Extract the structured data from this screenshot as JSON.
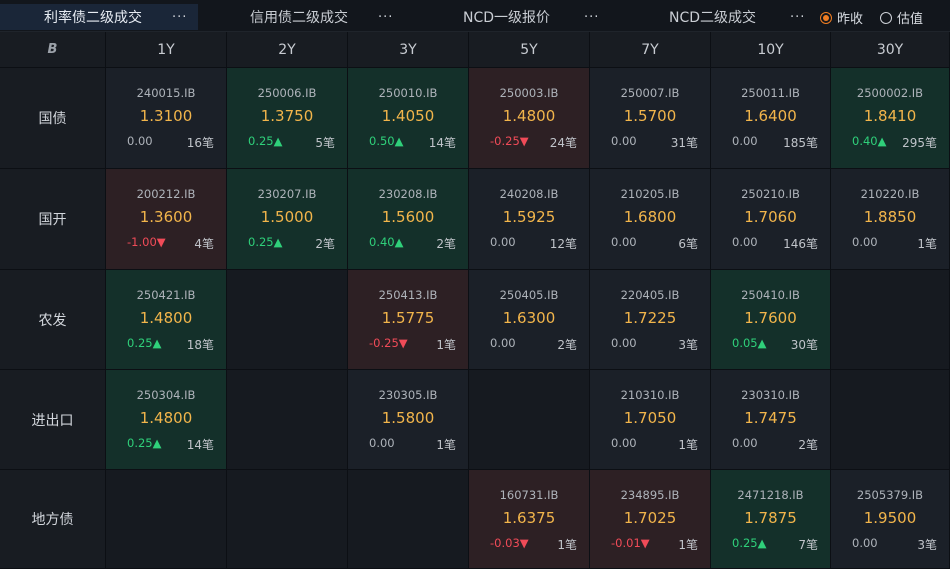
{
  "tabs": [
    {
      "label": "利率债二级成交",
      "active": true
    },
    {
      "label": "信用债二级成交",
      "active": false
    },
    {
      "label": "NCD一级报价",
      "active": false
    },
    {
      "label": "NCD二级成交",
      "active": false
    }
  ],
  "tab_more": "···",
  "price_mode": {
    "options": [
      "昨收",
      "估值"
    ],
    "selected": "昨收"
  },
  "columns": [
    "1Y",
    "2Y",
    "3Y",
    "5Y",
    "7Y",
    "10Y",
    "30Y"
  ],
  "corner_icon": "B",
  "rows": [
    {
      "label": "国债",
      "cells": [
        {
          "code": "240015.IB",
          "rate": "1.3100",
          "change": "0.00",
          "dir": "flat",
          "count": "16笔",
          "tone": "neu"
        },
        {
          "code": "250006.IB",
          "rate": "1.3750",
          "change": "0.25▲",
          "dir": "up",
          "count": "5笔",
          "tone": "up"
        },
        {
          "code": "250010.IB",
          "rate": "1.4050",
          "change": "0.50▲",
          "dir": "up",
          "count": "14笔",
          "tone": "up"
        },
        {
          "code": "250003.IB",
          "rate": "1.4800",
          "change": "-0.25▼",
          "dir": "down",
          "count": "24笔",
          "tone": "down"
        },
        {
          "code": "250007.IB",
          "rate": "1.5700",
          "change": "0.00",
          "dir": "flat",
          "count": "31笔",
          "tone": "neu"
        },
        {
          "code": "250011.IB",
          "rate": "1.6400",
          "change": "0.00",
          "dir": "flat",
          "count": "185笔",
          "tone": "neu"
        },
        {
          "code": "2500002.IB",
          "rate": "1.8410",
          "change": "0.40▲",
          "dir": "up",
          "count": "295笔",
          "tone": "up"
        }
      ]
    },
    {
      "label": "国开",
      "cells": [
        {
          "code": "200212.IB",
          "rate": "1.3600",
          "change": "-1.00▼",
          "dir": "down",
          "count": "4笔",
          "tone": "down"
        },
        {
          "code": "230207.IB",
          "rate": "1.5000",
          "change": "0.25▲",
          "dir": "up",
          "count": "2笔",
          "tone": "up"
        },
        {
          "code": "230208.IB",
          "rate": "1.5600",
          "change": "0.40▲",
          "dir": "up",
          "count": "2笔",
          "tone": "up"
        },
        {
          "code": "240208.IB",
          "rate": "1.5925",
          "change": "0.00",
          "dir": "flat",
          "count": "12笔",
          "tone": "neu"
        },
        {
          "code": "210205.IB",
          "rate": "1.6800",
          "change": "0.00",
          "dir": "flat",
          "count": "6笔",
          "tone": "neu"
        },
        {
          "code": "250210.IB",
          "rate": "1.7060",
          "change": "0.00",
          "dir": "flat",
          "count": "146笔",
          "tone": "neu"
        },
        {
          "code": "210220.IB",
          "rate": "1.8850",
          "change": "0.00",
          "dir": "flat",
          "count": "1笔",
          "tone": "neu"
        }
      ]
    },
    {
      "label": "农发",
      "cells": [
        {
          "code": "250421.IB",
          "rate": "1.4800",
          "change": "0.25▲",
          "dir": "up",
          "count": "18笔",
          "tone": "up"
        },
        null,
        {
          "code": "250413.IB",
          "rate": "1.5775",
          "change": "-0.25▼",
          "dir": "down",
          "count": "1笔",
          "tone": "down"
        },
        {
          "code": "250405.IB",
          "rate": "1.6300",
          "change": "0.00",
          "dir": "flat",
          "count": "2笔",
          "tone": "neu"
        },
        {
          "code": "220405.IB",
          "rate": "1.7225",
          "change": "0.00",
          "dir": "flat",
          "count": "3笔",
          "tone": "neu"
        },
        {
          "code": "250410.IB",
          "rate": "1.7600",
          "change": "0.05▲",
          "dir": "up",
          "count": "30笔",
          "tone": "up"
        },
        null
      ]
    },
    {
      "label": "进出口",
      "cells": [
        {
          "code": "250304.IB",
          "rate": "1.4800",
          "change": "0.25▲",
          "dir": "up",
          "count": "14笔",
          "tone": "up"
        },
        null,
        {
          "code": "230305.IB",
          "rate": "1.5800",
          "change": "0.00",
          "dir": "flat",
          "count": "1笔",
          "tone": "neu"
        },
        null,
        {
          "code": "210310.IB",
          "rate": "1.7050",
          "change": "0.00",
          "dir": "flat",
          "count": "1笔",
          "tone": "neu"
        },
        {
          "code": "230310.IB",
          "rate": "1.7475",
          "change": "0.00",
          "dir": "flat",
          "count": "2笔",
          "tone": "neu"
        },
        null
      ]
    },
    {
      "label": "地方债",
      "cells": [
        null,
        null,
        null,
        {
          "code": "160731.IB",
          "rate": "1.6375",
          "change": "-0.03▼",
          "dir": "down",
          "count": "1笔",
          "tone": "down"
        },
        {
          "code": "234895.IB",
          "rate": "1.7025",
          "change": "-0.01▼",
          "dir": "down",
          "count": "1笔",
          "tone": "down"
        },
        {
          "code": "2471218.IB",
          "rate": "1.7875",
          "change": "0.25▲",
          "dir": "up",
          "count": "7笔",
          "tone": "up"
        },
        {
          "code": "2505379.IB",
          "rate": "1.9500",
          "change": "0.00",
          "dir": "flat",
          "count": "3笔",
          "tone": "neu"
        }
      ]
    }
  ]
}
